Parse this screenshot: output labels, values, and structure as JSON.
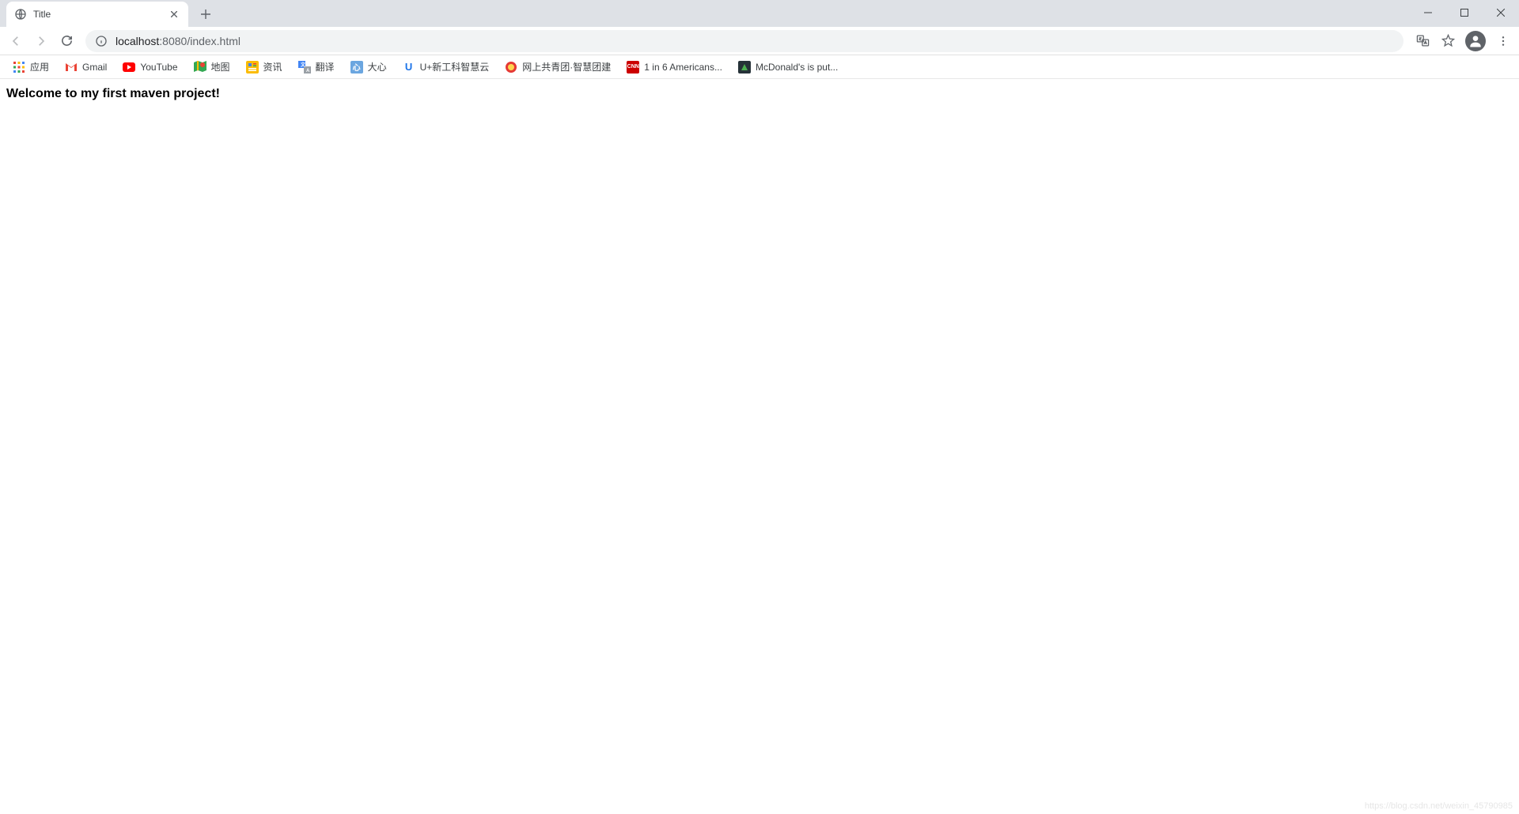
{
  "tab": {
    "title": "Title"
  },
  "url": {
    "host": "localhost",
    "port": ":8080",
    "path": "/index.html"
  },
  "bookmarks": [
    {
      "label": "应用",
      "type": "apps"
    },
    {
      "label": "Gmail",
      "type": "gmail"
    },
    {
      "label": "YouTube",
      "type": "youtube"
    },
    {
      "label": "地图",
      "type": "maps"
    },
    {
      "label": "资讯",
      "type": "news"
    },
    {
      "label": "翻译",
      "type": "translate"
    },
    {
      "label": "大心",
      "type": "generic-blue"
    },
    {
      "label": "U+新工科智慧云",
      "type": "u-blue"
    },
    {
      "label": "网上共青团·智慧团建",
      "type": "generic-red"
    },
    {
      "label": "1 in 6 Americans...",
      "type": "cnn"
    },
    {
      "label": "McDonald's is put...",
      "type": "generic-dark"
    }
  ],
  "content": {
    "heading": "Welcome to my first maven project!"
  },
  "watermark": "https://blog.csdn.net/weixin_45790985"
}
